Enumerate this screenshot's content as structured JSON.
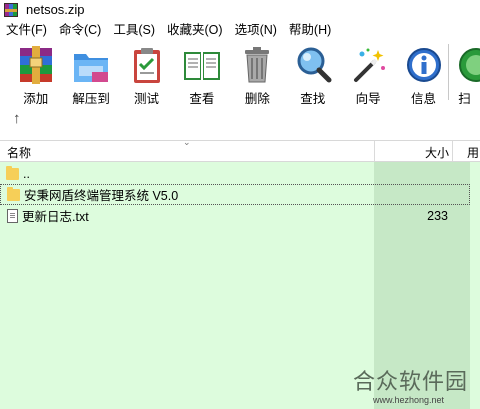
{
  "window": {
    "title": "netsos.zip",
    "icon": "winrar-icon"
  },
  "menu": [
    "文件(F)",
    "命令(C)",
    "工具(S)",
    "收藏夹(O)",
    "选项(N)",
    "帮助(H)"
  ],
  "toolbar": [
    {
      "label": "添加",
      "icon": "archive-add-icon"
    },
    {
      "label": "解压到",
      "icon": "extract-folder-icon"
    },
    {
      "label": "测试",
      "icon": "test-clipboard-icon"
    },
    {
      "label": "查看",
      "icon": "view-book-icon"
    },
    {
      "label": "删除",
      "icon": "trash-icon"
    },
    {
      "label": "查找",
      "icon": "search-magnifier-icon"
    },
    {
      "label": "向导",
      "icon": "wizard-wand-icon"
    },
    {
      "label": "信息",
      "icon": "info-icon"
    },
    {
      "label": "扫",
      "icon": "scan-icon"
    }
  ],
  "columns": {
    "name": "名称",
    "size": "大小",
    "next": "used"
  },
  "files": [
    {
      "name": "..",
      "size": "",
      "type": "folder"
    },
    {
      "name": "安秉网盾终端管理系统 V5.0",
      "size": "",
      "type": "folder"
    },
    {
      "name": "更新日志.txt",
      "size": "233",
      "type": "text"
    }
  ],
  "watermark": {
    "text": "合众软件园",
    "url": "www.hezhong.net"
  },
  "colors": {
    "list_bg": "#ddfcdd",
    "size_col_bg": "#c6e8c6",
    "folder": "#f6cf58"
  }
}
